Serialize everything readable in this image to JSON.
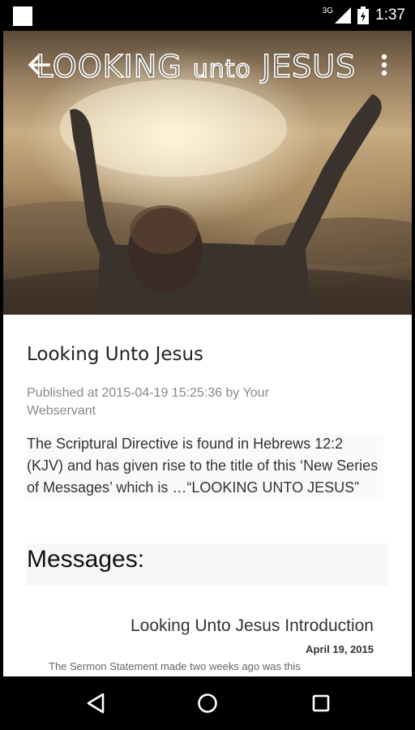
{
  "status_bar": {
    "time": "1:37",
    "network": "3G",
    "icons": [
      "notification-square-icon",
      "signal-icon",
      "battery-charging-icon"
    ]
  },
  "header": {
    "banner_text_1": "LOOKING ",
    "banner_text_2": "unto",
    "banner_text_3": " JESUS",
    "back_icon": "arrow-back-icon",
    "menu_icon": "more-vert-icon"
  },
  "article": {
    "title": "Looking Unto Jesus",
    "meta": "Published at 2015-04-19 15:25:36 by Your Webservant",
    "body": "The Scriptural Directive is found in Hebrews 12:2 (KJV) and has given rise to the title of this ‘New Series of Messages’ which is …“LOOKING UNTO JESUS”"
  },
  "messages": {
    "heading": "Messages:",
    "items": [
      {
        "title": "Looking Unto Jesus Introduction",
        "date": "April 19, 2015",
        "excerpt": "The Sermon Statement made two weeks ago was this"
      }
    ]
  },
  "nav_bar": {
    "icons": [
      "back-triangle-icon",
      "home-circle-icon",
      "recents-square-icon"
    ]
  }
}
